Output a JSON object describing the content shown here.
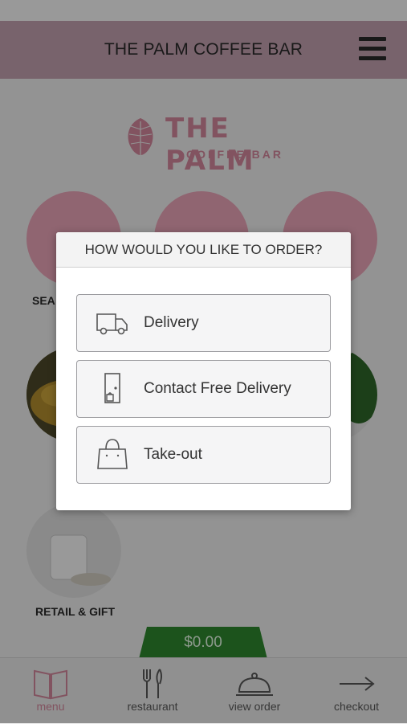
{
  "header": {
    "title": "THE PALM COFFEE BAR",
    "menu_icon": "hamburger-icon"
  },
  "logo": {
    "line1": "THE PALM",
    "line2": "COFFEE BAR",
    "icon": "palm-leaf-icon"
  },
  "categories": [
    {
      "label": "SEA",
      "icon": "seafood-icon"
    },
    {
      "label": "",
      "icon": "drink-icon"
    },
    {
      "label": "",
      "icon": "tag-icon"
    },
    {
      "label": "RETAIL & GIFT",
      "icon": "mug-photo"
    }
  ],
  "cart": {
    "total": "$0.00"
  },
  "bottom_nav": [
    {
      "label": "menu",
      "icon": "book-icon"
    },
    {
      "label": "restaurant",
      "icon": "fork-knife-icon"
    },
    {
      "label": "view order",
      "icon": "cloche-icon"
    },
    {
      "label": "checkout",
      "icon": "arrow-right-icon"
    }
  ],
  "modal": {
    "title": "HOW WOULD YOU LIKE TO ORDER?",
    "options": [
      {
        "label": "Delivery",
        "icon": "delivery-truck-icon"
      },
      {
        "label": "Contact Free Delivery",
        "icon": "door-bag-icon"
      },
      {
        "label": "Take-out",
        "icon": "shopping-bag-icon"
      }
    ]
  },
  "colors": {
    "header_bg": "#c9a5b4",
    "accent_pink": "#f1a9bd",
    "total_tab": "#2f8a2f",
    "active_nav": "#d98aa0"
  }
}
